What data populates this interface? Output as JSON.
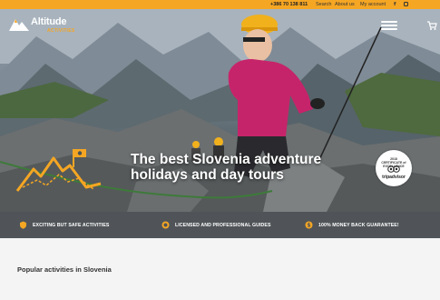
{
  "topbar": {
    "phone": "+386 70 138 811",
    "search": "Search",
    "about": "About us",
    "account": "My account",
    "facebook_icon": "facebook-icon",
    "instagram_icon": "instagram-icon"
  },
  "brand": {
    "name": "Altitude",
    "sub": "ACTIVITIES"
  },
  "header": {
    "menu_icon": "hamburger-menu-icon",
    "cart_icon": "cart-icon"
  },
  "hero": {
    "line1": "The best Slovenia adventure",
    "line2": "holidays and day tours"
  },
  "badge": {
    "line1": "2018",
    "line2": "CERTIFICATE of EXCELLENCE",
    "brand": "tripadvisor"
  },
  "features": [
    {
      "icon": "shield-icon",
      "label": "EXCITING BUT SAFE ACTIVITIES"
    },
    {
      "icon": "medal-icon",
      "label": "LICENSED AND PROFESSIONAL GUIDES"
    },
    {
      "icon": "money-icon",
      "label": "100% MONEY BACK GUARANTEE!"
    }
  ],
  "section": {
    "title": "Popular activities in Slovenia"
  },
  "colors": {
    "accent": "#f5a623",
    "feature_bar": "#505458"
  }
}
